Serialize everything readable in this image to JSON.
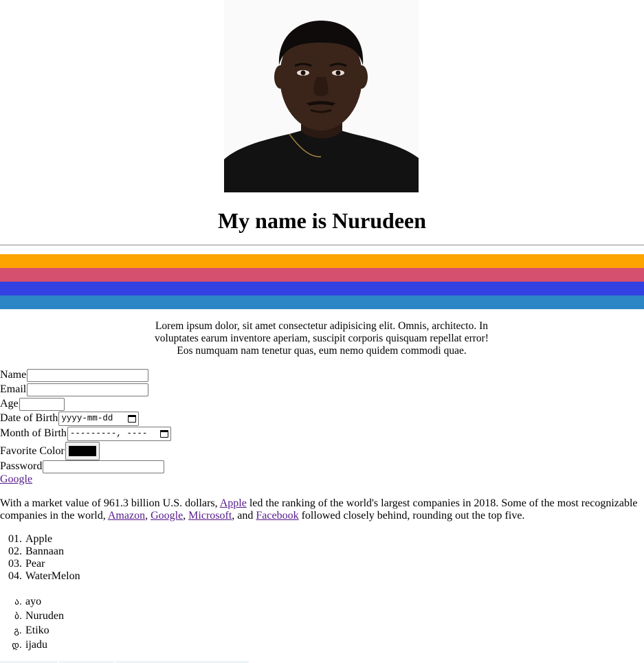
{
  "profile": {
    "photo_icon": "portrait-photo",
    "heading": "My name is Nurudeen"
  },
  "color_bands": [
    "#fea400",
    "#d5506f",
    "#3340e2",
    "#2c86c6"
  ],
  "intro_text": "Lorem ipsum dolor, sit amet consectetur adipisicing elit. Omnis, architecto. In voluptates earum inventore aperiam, suscipit corporis quisquam repellat error! Eos numquam nam tenetur quas, eum nemo quidem commodi quae.",
  "form": {
    "name_label": "Name",
    "name_value": "",
    "email_label": "Email",
    "email_value": "",
    "age_label": "Age",
    "age_value": "",
    "dob_label": "Date of Birth",
    "dob_placeholder": "yyyy-mm-dd",
    "month_label": "Month of Birth",
    "month_placeholder": "---------, ----",
    "color_label": "Favorite Color",
    "color_value": "#000000",
    "password_label": "Password",
    "password_value": ""
  },
  "google_link": "Google",
  "paragraph": {
    "p1": "With a market value of 961.3 billion U.S. dollars, ",
    "apple": "Apple",
    "p2": " led the ranking of the world's largest companies in 2018. Some of the most recognizable companies in the world, ",
    "amazon": "Amazon",
    "sep1": ", ",
    "google": "Google",
    "sep2": ", ",
    "microsoft": "Microsoft",
    "sep3": ", and ",
    "facebook": "Facebook",
    "p3": " followed closely behind, rounding out the top five."
  },
  "fruit_list": [
    {
      "marker": "01.",
      "label": "Apple"
    },
    {
      "marker": "02.",
      "label": "Bannaan"
    },
    {
      "marker": "03.",
      "label": "Pear"
    },
    {
      "marker": "04.",
      "label": "WaterMelon"
    }
  ],
  "name_list": [
    {
      "marker": "ა.",
      "label": "ayo"
    },
    {
      "marker": "ბ.",
      "label": "Nuruden"
    },
    {
      "marker": "გ.",
      "label": "Etiko"
    },
    {
      "marker": "დ.",
      "label": "ijadu"
    }
  ]
}
